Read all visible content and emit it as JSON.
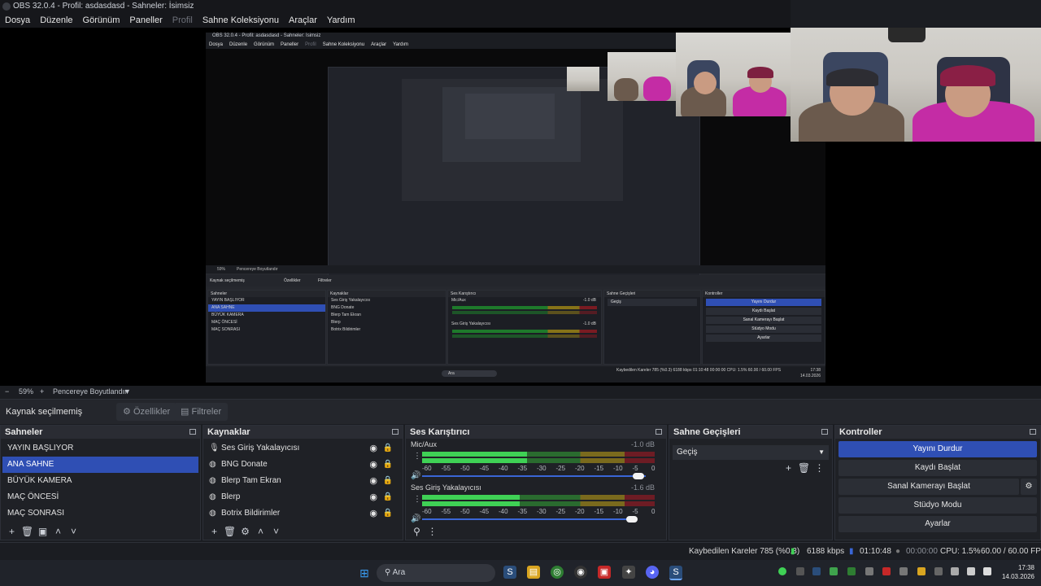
{
  "window": {
    "title": "OBS 32.0.4 - Profil: asdasdasd - Sahneler: İsimsiz"
  },
  "menu": [
    "Dosya",
    "Düzenle",
    "Görünüm",
    "Paneller",
    "Profil",
    "Sahne Koleksiyonu",
    "Araçlar",
    "Yardım"
  ],
  "zoom": {
    "value": "59%",
    "resize_label": "Pencereye Boyutlandır"
  },
  "source_bar": {
    "label": "Kaynak seçilmemiş",
    "properties": "Özellikler",
    "filters": "Filtreler"
  },
  "scenes": {
    "title": "Sahneler",
    "items": [
      "YAYIN BAŞLIYOR",
      "ANA SAHNE",
      "BÜYÜK KAMERA",
      "MAÇ ÖNCESİ",
      "MAÇ SONRASI"
    ],
    "selected": "ANA SAHNE"
  },
  "sources": {
    "title": "Kaynaklar",
    "items": [
      "Ses Giriş Yakalayıcısı",
      "BNG Donate",
      "Blerp Tam Ekran",
      "Blerp",
      "Botrix Bildirimler"
    ]
  },
  "mixer": {
    "title": "Ses Karıştırıcı",
    "channels": [
      {
        "name": "Mic/Aux",
        "db": "-1.0 dB",
        "level": 0.45
      },
      {
        "name": "Ses Giriş Yakalayıcısı",
        "db": "-1.6 dB",
        "level": 0.42
      }
    ],
    "scale": [
      "-60",
      "-55",
      "-50",
      "-45",
      "-40",
      "-35",
      "-30",
      "-25",
      "-20",
      "-15",
      "-10",
      "-5",
      "0"
    ]
  },
  "transitions": {
    "title": "Sahne Geçişleri",
    "selected": "Geçiş"
  },
  "controls": {
    "title": "Kontroller",
    "buttons": [
      "Yayını Durdur",
      "Kaydı Başlat",
      "Sanal Kamerayı Başlat",
      "Stüdyo Modu",
      "Ayarlar"
    ]
  },
  "status": {
    "dropped": "Kaybedilen Kareler 785 (%0.3)",
    "bitrate": "6188 kbps",
    "stream_time": "01:10:48",
    "rec_time": "00:00:00",
    "cpu": "CPU: 1.5%",
    "fps": "60.00 / 60.00 FPS"
  },
  "taskbar": {
    "search": "Ara",
    "time": "17:38",
    "date": "14.03.2026"
  },
  "nested": {
    "title": "OBS 32.0.4 - Profil: asdasdasd - Sahneler: İsimsiz",
    "menu": [
      "Dosya",
      "Düzenle",
      "Görünüm",
      "Paneller",
      "Profil",
      "Sahne Koleksiyonu",
      "Araçlar",
      "Yardım"
    ],
    "zoom": "59%",
    "resize": "Pencereye Boyutlandır",
    "source_label": "Kaynak seçilmemiş",
    "props": "Özellikler",
    "filters": "Filtreler",
    "scenes_title": "Sahneler",
    "scenes": [
      "YAYIN BAŞLIYOR",
      "ANA SAHNE",
      "BÜYÜK KAMERA",
      "MAÇ ÖNCESİ",
      "MAÇ SONRASI"
    ],
    "sources_title": "Kaynaklar",
    "sources": [
      "Ses Giriş Yakalayıcısı",
      "BNG Donate",
      "Blerp Tam Ekran",
      "Blerp",
      "Botrix Bildirimler"
    ],
    "mixer_title": "Ses Karıştırıcı",
    "mic": "Mic/Aux",
    "mic_db": "-1.0 dB",
    "sgy": "Ses Giriş Yakalayıcısı",
    "sgy_db": "-1.0 dB",
    "trans_title": "Sahne Geçişleri",
    "trans": "Geçiş",
    "ctl_title": "Kontroller",
    "ctl": [
      "Yayını Durdur",
      "Kaydı Başlat",
      "Sanal Kamerayı Başlat",
      "Stüdyo Modu",
      "Ayarlar"
    ],
    "status": "Kaybedilen Kareler 785 (%0.3)   6188 kbps   01:10:48   00:00:00   CPU: 1.5%   60.00 / 60.00 FPS",
    "search": "Ara",
    "time": "17:38",
    "date": "14.03.2026"
  },
  "colors": {
    "accent": "#2f4fb4",
    "bg": "#1b1d22",
    "meter_green": "#3fd155",
    "meter_yellow": "#7a6a1d",
    "meter_red": "#6d1c24"
  }
}
